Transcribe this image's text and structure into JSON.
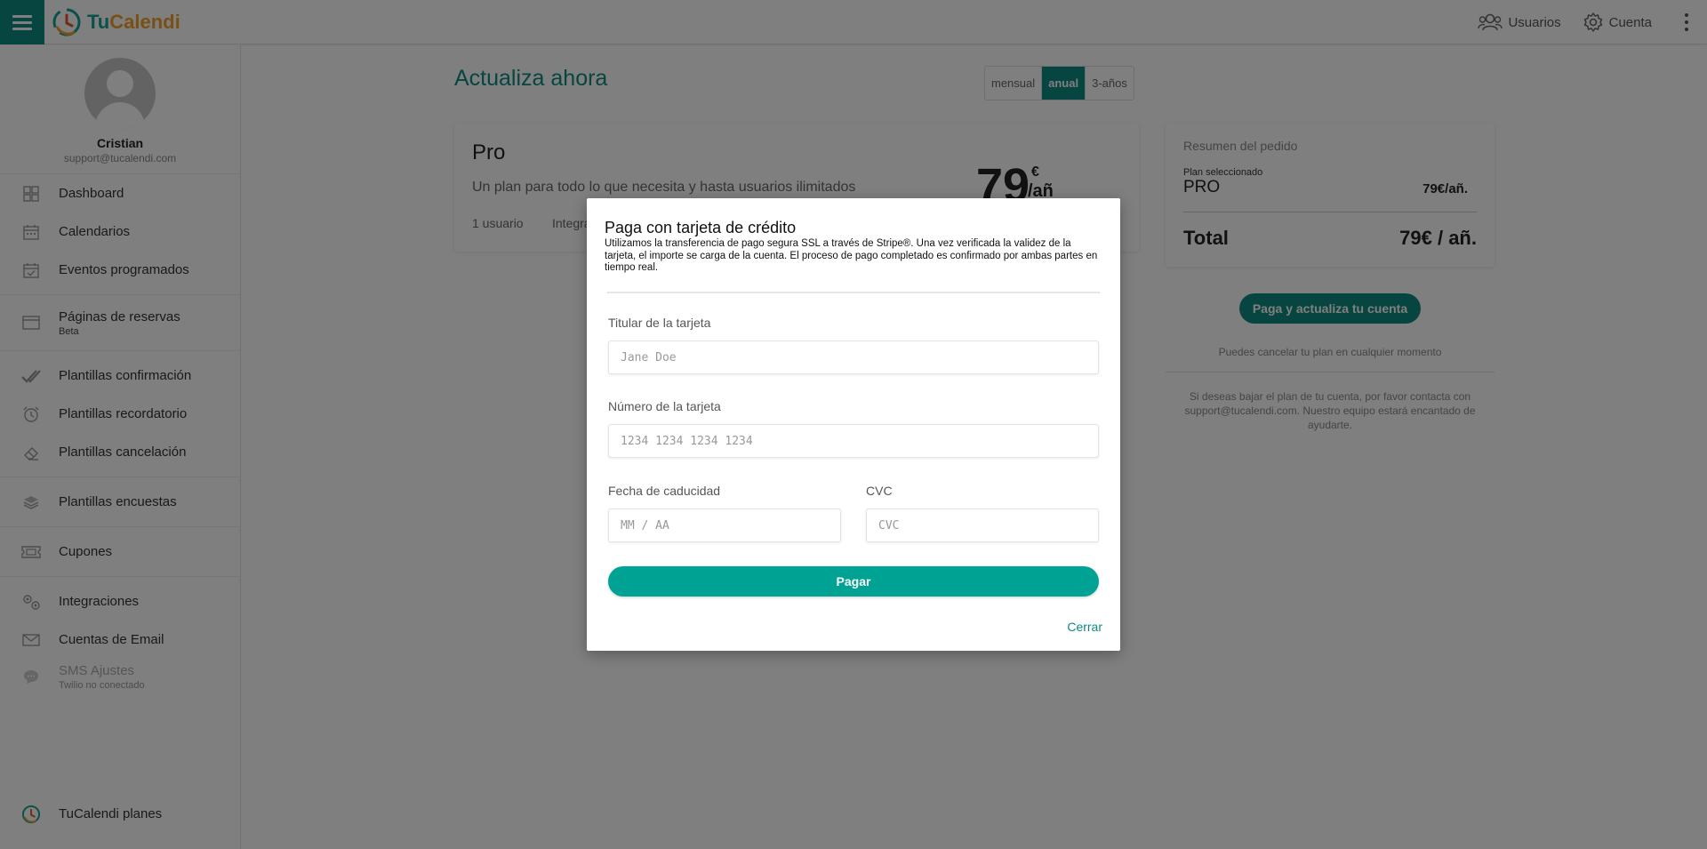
{
  "colors": {
    "accent": "#0d8a80",
    "pay": "#00a393",
    "brand_orange": "#f0a02c"
  },
  "topbar": {
    "brand_tu": "Tu",
    "brand_cal": "Calendi",
    "users_label": "Usuarios",
    "account_label": "Cuenta"
  },
  "sidebar": {
    "profile_name": "Cristian",
    "profile_email": "support@tucalendi.com",
    "items": [
      {
        "label": "Dashboard",
        "icon": "grid-icon"
      },
      {
        "label": "Calendarios",
        "icon": "calendar-icon"
      },
      {
        "label": "Eventos programados",
        "icon": "calendar-check-icon"
      },
      {
        "label": "Páginas de reservas",
        "sub": "Beta",
        "icon": "window-icon"
      },
      {
        "label": "Plantillas confirmación",
        "icon": "double-check-icon"
      },
      {
        "label": "Plantillas recordatorio",
        "icon": "alarm-icon"
      },
      {
        "label": "Plantillas cancelación",
        "icon": "eraser-icon"
      },
      {
        "label": "Plantillas encuestas",
        "icon": "layers-icon"
      },
      {
        "label": "Cupones",
        "icon": "ticket-icon"
      },
      {
        "label": "Integraciones",
        "icon": "gears-icon"
      },
      {
        "label": "Cuentas de Email",
        "icon": "mail-icon"
      },
      {
        "label": "SMS Ajustes",
        "sub": "Twilio no conectado",
        "icon": "chat-icon"
      }
    ],
    "plans_label": "TuCalendi planes"
  },
  "main": {
    "title": "Actualiza ahora",
    "periods": [
      "mensual",
      "anual",
      "3-años"
    ],
    "selected_period": "anual",
    "plan": {
      "name": "Pro",
      "description": "Un plan para todo lo que necesita y hasta usuarios ilimitados",
      "feature_users": "1 usuario",
      "feature_integrations": "Integra",
      "price": "79",
      "currency": "€",
      "per": "/añ"
    }
  },
  "summary": {
    "title": "Resumen del pedido",
    "selected_label": "Plan seleccionado",
    "plan_code": "PRO",
    "plan_price": "79€/añ.",
    "total_label": "Total",
    "total_price": "79€ / añ.",
    "pay_upgrade_label": "Paga y actualiza tu cuenta",
    "cancel_note": "Puedes cancelar tu plan en cualquier momento",
    "downgrade_note": "Si deseas bajar el plan de tu cuenta, por favor contacta con support@tucalendi.com. Nuestro equipo estará encantado de ayudarte."
  },
  "modal": {
    "title": "Paga con tarjeta de crédito",
    "description": "Utilizamos la transferencia de pago segura SSL a través de Stripe®. Una vez verificada la validez de la tarjeta, el importe se carga de la cuenta. El proceso de pago completado es confirmado por ambas partes en tiempo real.",
    "holder_label": "Titular de la tarjeta",
    "holder_placeholder": "Jane Doe",
    "number_label": "Número de la tarjeta",
    "number_placeholder": "1234 1234 1234 1234",
    "expiry_label": "Fecha de caducidad",
    "expiry_placeholder": "MM / AA",
    "cvc_label": "CVC",
    "cvc_placeholder": "CVC",
    "pay_label": "Pagar",
    "close_label": "Cerrar"
  }
}
